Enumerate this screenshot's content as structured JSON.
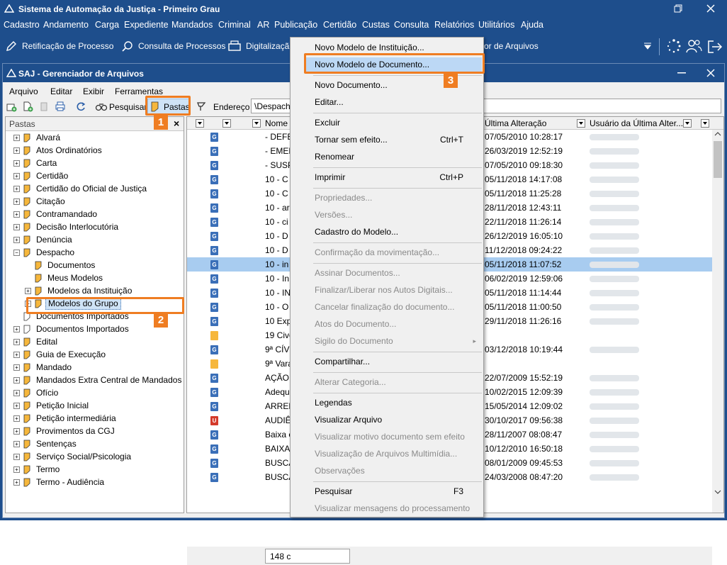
{
  "app": {
    "title": "Sistema de Automação da Justiça - Primeiro Grau",
    "menu": [
      "Cadastro",
      "Andamento",
      "Carga",
      "Expediente",
      "Mandados",
      "Criminal",
      "AR",
      "Publicação",
      "Certidão",
      "Custas",
      "Consulta",
      "Relatórios",
      "Utilitários",
      "Ajuda"
    ],
    "toolbar": {
      "retificacao": "Retificação de Processo",
      "consulta": "Consulta de Processos",
      "digitalizacao": "Digitalizaçã",
      "gerenciador": "or de Arquivos"
    }
  },
  "window": {
    "title": "SAJ - Gerenciador de Arquivos",
    "menu": [
      "Arquivo",
      "Editar",
      "Exibir",
      "Ferramentas"
    ],
    "toolbar": {
      "pesquisar": "Pesquisar",
      "pastas": "Pastas",
      "endereco_label": "Endereço",
      "endereco_value": "\\Despacho"
    }
  },
  "tree": {
    "header": "Pastas",
    "items": [
      {
        "label": "Alvará",
        "level": 0,
        "expander": "+"
      },
      {
        "label": "Atos Ordinatórios",
        "level": 0,
        "expander": "+"
      },
      {
        "label": "Carta",
        "level": 0,
        "expander": "+"
      },
      {
        "label": "Certidão",
        "level": 0,
        "expander": "+"
      },
      {
        "label": "Certidão do Oficial de Justiça",
        "level": 0,
        "expander": "+"
      },
      {
        "label": "Citação",
        "level": 0,
        "expander": "+"
      },
      {
        "label": "Contramandado",
        "level": 0,
        "expander": "+"
      },
      {
        "label": "Decisão Interlocutória",
        "level": 0,
        "expander": "+"
      },
      {
        "label": "Denúncia",
        "level": 0,
        "expander": "+"
      },
      {
        "label": "Despacho",
        "level": 0,
        "expander": "-"
      },
      {
        "label": "Documentos",
        "level": 1,
        "expander": ""
      },
      {
        "label": "Meus Modelos",
        "level": 1,
        "expander": ""
      },
      {
        "label": "Modelos da Instituição",
        "level": 1,
        "expander": "+"
      },
      {
        "label": "Modelos do Grupo",
        "level": 1,
        "expander": "+",
        "selected": true
      },
      {
        "label": "Documentos Importados",
        "level": 0,
        "expander": ""
      },
      {
        "label": "Documentos Importados",
        "level": 0,
        "expander": "+"
      },
      {
        "label": "Edital",
        "level": 0,
        "expander": "+"
      },
      {
        "label": "Guia de Execução",
        "level": 0,
        "expander": "+"
      },
      {
        "label": "Mandado",
        "level": 0,
        "expander": "+"
      },
      {
        "label": "Mandados Extra Central de Mandados",
        "level": 0,
        "expander": "+"
      },
      {
        "label": "Ofício",
        "level": 0,
        "expander": "+"
      },
      {
        "label": "Petição Inicial",
        "level": 0,
        "expander": "+"
      },
      {
        "label": "Petição intermediária",
        "level": 0,
        "expander": "+"
      },
      {
        "label": "Provimentos da CGJ",
        "level": 0,
        "expander": "+"
      },
      {
        "label": "Sentenças",
        "level": 0,
        "expander": "+"
      },
      {
        "label": "Serviço Social/Psicologia",
        "level": 0,
        "expander": "+"
      },
      {
        "label": "Termo",
        "level": 0,
        "expander": "+"
      },
      {
        "label": "Termo - Audiência",
        "level": 0,
        "expander": "+"
      }
    ]
  },
  "grid": {
    "columns": {
      "nome": "Nome",
      "ultima_alteracao": "Última Alteração",
      "usuario": "Usuário da Última Alter..."
    },
    "rows": [
      {
        "icon": "G",
        "name": "- DEFE",
        "date": "07/05/2010 10:28:17"
      },
      {
        "icon": "G",
        "name": "- EMER",
        "date": "26/03/2019 12:52:19"
      },
      {
        "icon": "G",
        "name": "- SUSP",
        "date": "07/05/2010 09:18:30"
      },
      {
        "icon": "G",
        "name": "10 -  C",
        "date": "05/11/2018 14:17:08"
      },
      {
        "icon": "G",
        "name": "10 -   C",
        "date": "05/11/2018 11:25:28"
      },
      {
        "icon": "G",
        "name": "10 - ar",
        "date": "28/11/2018 12:43:11"
      },
      {
        "icon": "G",
        "name": "10 - ci",
        "date": "22/11/2018 11:26:14"
      },
      {
        "icon": "G",
        "name": "10 - D",
        "date": "26/12/2019 16:05:10"
      },
      {
        "icon": "G",
        "name": "10 - D",
        "date": "11/12/2018 09:24:22"
      },
      {
        "icon": "G",
        "name": "10 - in",
        "date": "05/11/2018 11:07:52",
        "selected": true
      },
      {
        "icon": "G",
        "name": "10 - In",
        "date": "06/02/2019 12:59:06"
      },
      {
        "icon": "G",
        "name": "10 - IN",
        "date": "05/11/2018 11:14:44"
      },
      {
        "icon": "G",
        "name": "10 - O",
        "date": "05/11/2018 11:00:50"
      },
      {
        "icon": "G",
        "name": "10 Exp",
        "date": "29/11/2018 11:26:16"
      },
      {
        "icon": "F",
        "name": "19 Cive",
        "date": ""
      },
      {
        "icon": "G",
        "name": "9ª CÍV",
        "date": "03/12/2018 10:19:44"
      },
      {
        "icon": "F",
        "name": "9ª Vara",
        "date": ""
      },
      {
        "icon": "G",
        "name": "AÇÃO",
        "date": "22/07/2009 15:52:19"
      },
      {
        "icon": "G",
        "name": "Adequ",
        "date": "10/02/2015 12:09:39"
      },
      {
        "icon": "G",
        "name": "ARREN",
        "date": "15/05/2014 12:09:02"
      },
      {
        "icon": "U",
        "name": "AUDIÊ",
        "date": "30/10/2017 09:56:38"
      },
      {
        "icon": "G",
        "name": "Baixa e",
        "date": "28/11/2007 08:08:47"
      },
      {
        "icon": "G",
        "name": "BAIXAR",
        "date": "10/12/2010 16:50:18"
      },
      {
        "icon": "G",
        "name": "BUSCA",
        "date": "08/01/2009 09:45:53"
      },
      {
        "icon": "G",
        "name": "BUSCA",
        "date": "24/03/2008 08:47:20"
      }
    ],
    "status": "148 c"
  },
  "context_menu": {
    "items": [
      {
        "label": "Novo Modelo de Instituição...",
        "shortcut": "",
        "disabled": false
      },
      {
        "label": "Novo Modelo de Documento...",
        "shortcut": "",
        "disabled": false,
        "highlighted": true
      },
      {
        "label": "Novo Documento...",
        "shortcut": "",
        "disabled": false
      },
      {
        "label": "Editar...",
        "shortcut": "",
        "disabled": false
      },
      {
        "label": "Excluir",
        "shortcut": "",
        "disabled": false
      },
      {
        "label": "Tornar sem efeito...",
        "shortcut": "Ctrl+T",
        "disabled": false
      },
      {
        "label": "Renomear",
        "shortcut": "",
        "disabled": false
      },
      {
        "label": "Imprimir",
        "shortcut": "Ctrl+P",
        "disabled": false
      },
      {
        "label": "Propriedades...",
        "shortcut": "",
        "disabled": true
      },
      {
        "label": "Versões...",
        "shortcut": "",
        "disabled": true
      },
      {
        "label": "Cadastro do Modelo...",
        "shortcut": "",
        "disabled": false
      },
      {
        "label": "Confirmação da movimentação...",
        "shortcut": "",
        "disabled": true
      },
      {
        "label": "Assinar Documentos...",
        "shortcut": "",
        "disabled": true
      },
      {
        "label": "Finalizar/Liberar nos Autos Digitais...",
        "shortcut": "",
        "disabled": true
      },
      {
        "label": "Cancelar finalização do documento...",
        "shortcut": "",
        "disabled": true
      },
      {
        "label": "Atos do Documento...",
        "shortcut": "",
        "disabled": true
      },
      {
        "label": "Sigilo do Documento",
        "shortcut": "",
        "disabled": true,
        "submenu": true
      },
      {
        "label": "Compartilhar...",
        "shortcut": "",
        "disabled": false
      },
      {
        "label": "Alterar Categoria...",
        "shortcut": "",
        "disabled": true
      },
      {
        "label": "Legendas",
        "shortcut": "",
        "disabled": false
      },
      {
        "label": "Visualizar Arquivo",
        "shortcut": "",
        "disabled": false
      },
      {
        "label": "Visualizar motivo documento sem efeito",
        "shortcut": "",
        "disabled": true
      },
      {
        "label": "Visualização de Arquivos Multimídia...",
        "shortcut": "",
        "disabled": true
      },
      {
        "label": "Observações",
        "shortcut": "",
        "disabled": true
      },
      {
        "label": "Pesquisar",
        "shortcut": "F3",
        "disabled": false
      },
      {
        "label": "Visualizar mensagens do processamento",
        "shortcut": "",
        "disabled": true
      }
    ]
  },
  "callouts": [
    "1",
    "2",
    "3"
  ],
  "colors": {
    "title_bar": "#1e4e8c",
    "highlight": "#ef7d22",
    "selection": "#a8ccf0"
  }
}
